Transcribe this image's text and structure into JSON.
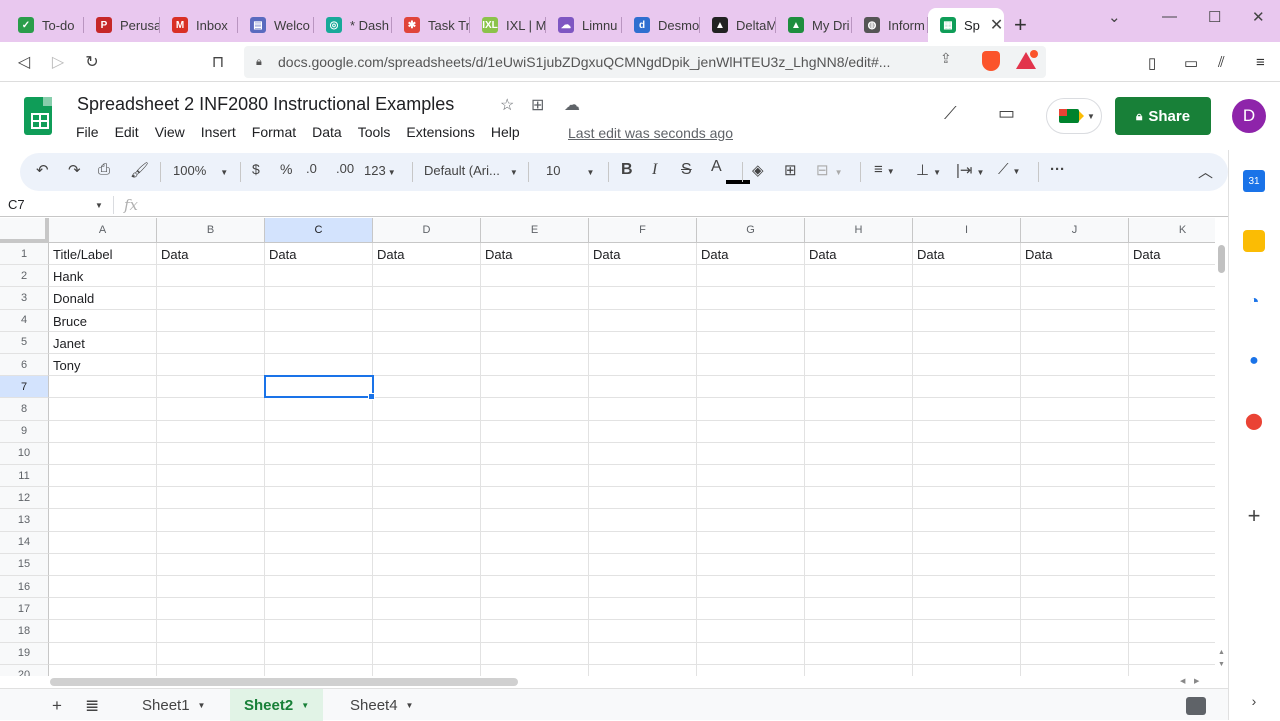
{
  "browser": {
    "tabs": [
      {
        "label": "To-do",
        "color": "#2a9d4a",
        "glyph": "✓"
      },
      {
        "label": "Perusa",
        "color": "#c62828",
        "glyph": "P"
      },
      {
        "label": "Inbox",
        "color": "#d93025",
        "glyph": "M"
      },
      {
        "label": "Welco",
        "color": "#5a6abf",
        "glyph": "▤"
      },
      {
        "label": "* Dash",
        "color": "#18a999",
        "glyph": "◎"
      },
      {
        "label": "Task Tr",
        "color": "#e0453a",
        "glyph": "✱"
      },
      {
        "label": "IXL | M",
        "color": "#8bc34a",
        "glyph": "IXL"
      },
      {
        "label": "Limnu",
        "color": "#7e57c2",
        "glyph": "☁"
      },
      {
        "label": "Desmo",
        "color": "#2f6fd0",
        "glyph": "d"
      },
      {
        "label": "DeltaM",
        "color": "#222222",
        "glyph": "▲"
      },
      {
        "label": "My Dri",
        "color": "#1e8e3e",
        "glyph": "▲"
      },
      {
        "label": "Inform",
        "color": "#555555",
        "glyph": "◍"
      },
      {
        "label": "Sp",
        "color": "#0f9d58",
        "glyph": "▦"
      }
    ],
    "url": "docs.google.com/spreadsheets/d/1eUwiS1jubZDgxuQCMNgdDpik_jenWlHTEU3z_LhgNN8/edit#..."
  },
  "doc": {
    "title": "Spreadsheet 2 INF2080 Instructional Examples",
    "menu": [
      "File",
      "Edit",
      "View",
      "Insert",
      "Format",
      "Data",
      "Tools",
      "Extensions",
      "Help"
    ],
    "last_edit": "Last edit was seconds ago",
    "share_label": "Share",
    "avatar_initial": "D"
  },
  "toolbar": {
    "zoom": "100%",
    "currency": "$",
    "percent": "%",
    "dec_decrease": ".0",
    "dec_increase": ".00",
    "format_more": "123",
    "font": "Default (Ari...",
    "font_size": "10",
    "bold": "B",
    "italic": "I",
    "strike": "S",
    "text_color": "A",
    "more": "···"
  },
  "formula_bar": {
    "name_box": "C7",
    "fx_label": "fx"
  },
  "grid": {
    "columns": [
      "A",
      "B",
      "C",
      "D",
      "E",
      "F",
      "G",
      "H",
      "I",
      "J",
      "K"
    ],
    "selected_column": "C",
    "rows": [
      "1",
      "2",
      "3",
      "4",
      "5",
      "6",
      "7",
      "8",
      "9",
      "10",
      "11",
      "12",
      "13",
      "14",
      "15",
      "16",
      "17",
      "18",
      "19",
      "20"
    ],
    "selected_row": "7",
    "header_row": [
      "Title/Label",
      "Data",
      "Data",
      "Data",
      "Data",
      "Data",
      "Data",
      "Data",
      "Data",
      "Data",
      "Data"
    ],
    "labels": [
      "Hank",
      "Donald",
      "Bruce",
      "Janet",
      "Tony"
    ]
  },
  "sheets": [
    {
      "name": "Sheet1",
      "active": false
    },
    {
      "name": "Sheet2",
      "active": true
    },
    {
      "name": "Sheet4",
      "active": false
    }
  ]
}
